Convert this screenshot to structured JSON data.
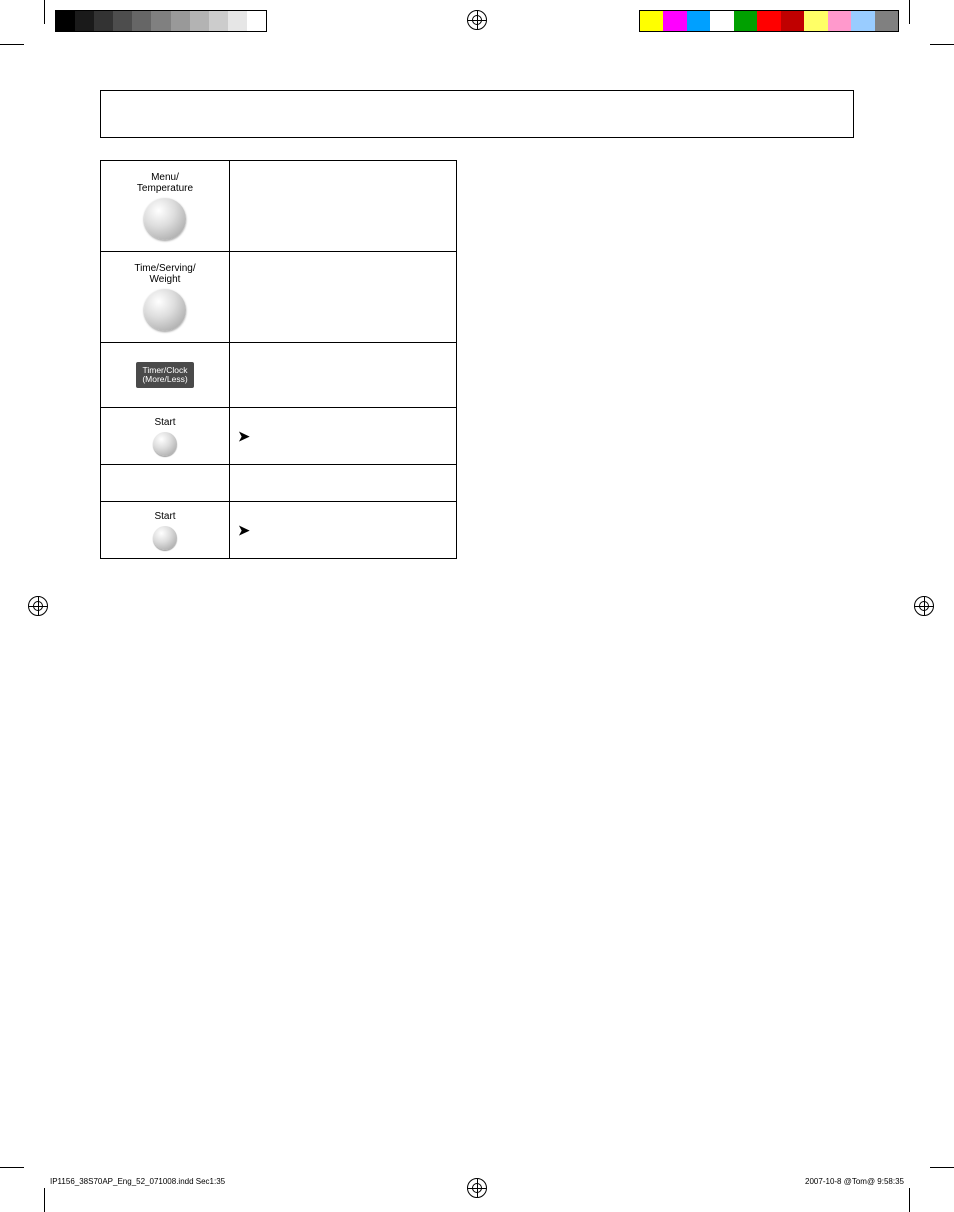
{
  "color_bar_left": [
    "#000000",
    "#1a1a1a",
    "#333333",
    "#4d4d4d",
    "#666666",
    "#808080",
    "#999999",
    "#b3b3b3",
    "#cccccc",
    "#e6e6e6",
    "#ffffff"
  ],
  "color_bar_right": [
    "#ffff00",
    "#ff00ff",
    "#00a0ff",
    "#ffffff",
    "#00a000",
    "#ff0000",
    "#c00000",
    "#ffff66",
    "#ff99cc",
    "#99ccff",
    "#808080"
  ],
  "steps": {
    "row1_label_top": "Menu/",
    "row1_label_bottom": "Temperature",
    "row2_label_top": "Time/Serving/",
    "row2_label_bottom": "Weight",
    "row3_keycap_top": "Timer/Clock",
    "row3_keycap_bottom": "(More/Less)",
    "row4_label": "Start",
    "row4_arrow": "➤",
    "row6_label": "Start",
    "row6_arrow": "➤"
  },
  "footer": {
    "left": "IP1156_38S70AP_Eng_52_071008.indd   Sec1:35",
    "right": "2007-10-8   @Tom@  9:58:35"
  }
}
